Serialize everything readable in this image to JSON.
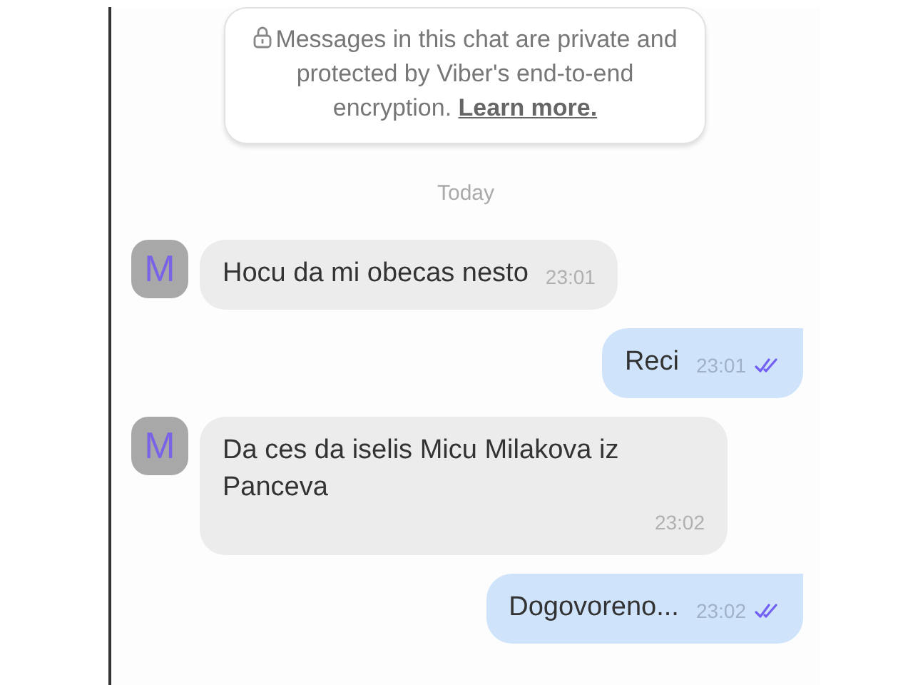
{
  "notice": {
    "text": "Messages in this chat are private and protected by Viber's end-to-end encryption.",
    "link": "Learn more."
  },
  "date_divider": "Today",
  "messages": [
    {
      "kind": "incoming",
      "avatar": "M",
      "text": "Hocu da mi obecas nesto",
      "time": "23:01"
    },
    {
      "kind": "outgoing",
      "text": "Reci",
      "time": "23:01",
      "read": true
    },
    {
      "kind": "incoming",
      "avatar": "M",
      "text": "Da ces da iselis Micu Milakova iz Panceva",
      "time": "23:02"
    },
    {
      "kind": "outgoing",
      "text": "Dogovoreno...",
      "time": "23:02",
      "read": true
    }
  ]
}
